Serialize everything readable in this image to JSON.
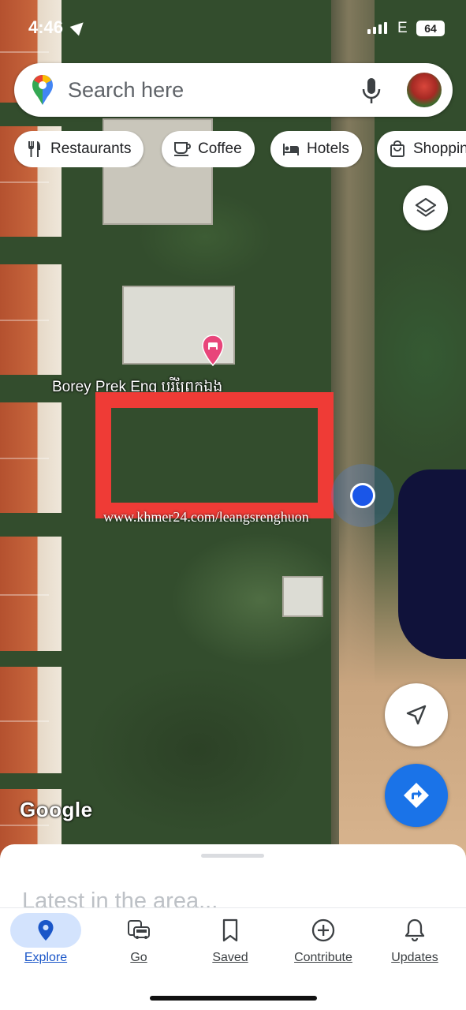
{
  "status_bar": {
    "time": "4:46",
    "network": "E",
    "battery": "64"
  },
  "search": {
    "placeholder": "Search here"
  },
  "chips": [
    {
      "label": "Restaurants",
      "icon": "fork-knife-icon"
    },
    {
      "label": "Coffee",
      "icon": "coffee-cup-icon"
    },
    {
      "label": "Hotels",
      "icon": "bed-icon"
    },
    {
      "label": "Shopping",
      "icon": "shopping-bag-icon"
    }
  ],
  "map": {
    "place_label": "Borey Prek Eng បុរីព្រែកឯង",
    "watermark": "www.khmer24.com/leangsrenghuon",
    "attribution": "Google"
  },
  "bottom_sheet": {
    "title": "Latest in the area..."
  },
  "tabs": [
    {
      "label": "Explore",
      "icon": "location-pin-icon",
      "active": true
    },
    {
      "label": "Go",
      "icon": "commute-icon",
      "active": false
    },
    {
      "label": "Saved",
      "icon": "bookmark-icon",
      "active": false
    },
    {
      "label": "Contribute",
      "icon": "add-circle-icon",
      "active": false
    },
    {
      "label": "Updates",
      "icon": "bell-icon",
      "active": false
    }
  ],
  "colors": {
    "accent": "#1a73e8",
    "highlight_box": "#ef3b36",
    "active_tab_pill": "#d3e3fd"
  }
}
